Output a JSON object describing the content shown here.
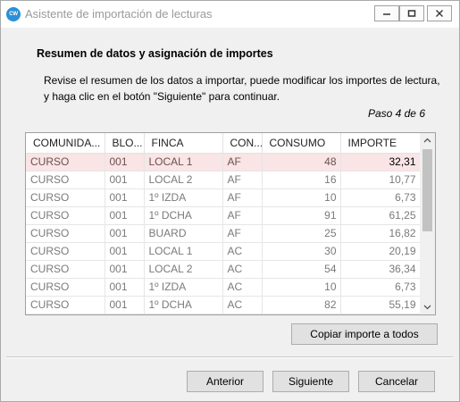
{
  "window": {
    "title": "Asistente de importación de lecturas",
    "app_icon_text": "CW"
  },
  "heading": "Resumen de datos y asignación de importes",
  "instructions": "Revise el resumen de los datos a importar, puede modificar los importes de lectura, y haga clic en el botón \"Siguiente\" para continuar.",
  "step": "Paso 4 de 6",
  "table": {
    "columns": [
      "COMUNIDA...",
      "BLO...",
      "FINCA",
      "CON...",
      "CONSUMO",
      "IMPORTE"
    ],
    "rows": [
      [
        "CURSO",
        "001",
        "LOCAL 1",
        "AF",
        "48",
        "32,31"
      ],
      [
        "CURSO",
        "001",
        "LOCAL 2",
        "AF",
        "16",
        "10,77"
      ],
      [
        "CURSO",
        "001",
        "1º IZDA",
        "AF",
        "10",
        "6,73"
      ],
      [
        "CURSO",
        "001",
        "1º DCHA",
        "AF",
        "91",
        "61,25"
      ],
      [
        "CURSO",
        "001",
        "BUARD",
        "AF",
        "25",
        "16,82"
      ],
      [
        "CURSO",
        "001",
        "LOCAL 1",
        "AC",
        "30",
        "20,19"
      ],
      [
        "CURSO",
        "001",
        "LOCAL 2",
        "AC",
        "54",
        "36,34"
      ],
      [
        "CURSO",
        "001",
        "1º IZDA",
        "AC",
        "10",
        "6,73"
      ],
      [
        "CURSO",
        "001",
        "1º DCHA",
        "AC",
        "82",
        "55,19"
      ]
    ],
    "selected_row": 0
  },
  "buttons": {
    "copy": "Copiar importe a todos",
    "previous": "Anterior",
    "next": "Siguiente",
    "cancel": "Cancelar"
  },
  "icons": {
    "minimize": "minimize-icon",
    "maximize": "maximize-icon",
    "close": "close-icon"
  }
}
